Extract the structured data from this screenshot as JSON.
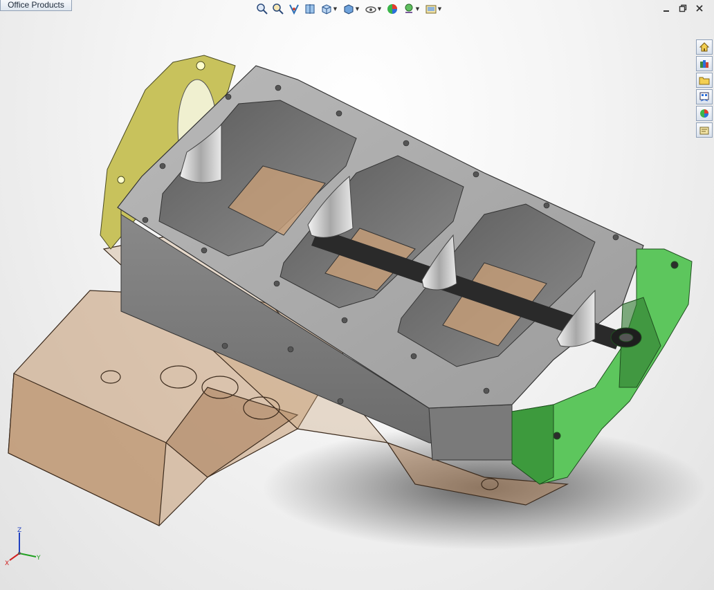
{
  "office_tab": {
    "label": "Office Products"
  },
  "view_toolbar": {
    "buttons": [
      {
        "name": "zoom-to-fit-icon"
      },
      {
        "name": "zoom-to-area-icon"
      },
      {
        "name": "previous-view-icon"
      },
      {
        "name": "section-view-icon"
      },
      {
        "name": "view-orientation-icon",
        "dropdown": true
      },
      {
        "name": "display-style-icon",
        "dropdown": true
      },
      {
        "name": "hide-show-items-icon",
        "dropdown": true
      },
      {
        "name": "edit-appearance-icon"
      },
      {
        "name": "apply-scene-icon",
        "dropdown": true
      },
      {
        "name": "view-settings-icon",
        "dropdown": true
      }
    ]
  },
  "window_controls": [
    "minimize-icon",
    "restore-icon",
    "close-icon"
  ],
  "task_pane": [
    "home-icon",
    "design-library-icon",
    "file-explorer-icon",
    "view-palette-icon",
    "appearances-icon",
    "custom-properties-icon"
  ],
  "triad": {
    "x": "X",
    "y": "Y",
    "z": "Z"
  },
  "colors": {
    "block_gray": "#a9a9a9",
    "oil_pan_bronze": "#c8a07a",
    "front_cover_yellow": "#c9c35a",
    "rear_cover_green": "#5fc75f"
  }
}
